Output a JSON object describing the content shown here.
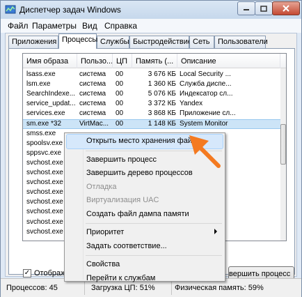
{
  "window": {
    "title": "Диспетчер задач Windows"
  },
  "menu": [
    "Файл",
    "Параметры",
    "Вид",
    "Справка"
  ],
  "tabs": [
    "Приложения",
    "Процессы",
    "Службы",
    "Быстродействие",
    "Сеть",
    "Пользователи"
  ],
  "active_tab": "Процессы",
  "table": {
    "headers": [
      "Имя образа",
      "Пользо...",
      "ЦП",
      "Память (...",
      "Описание"
    ],
    "rows": [
      {
        "name": "lsass.exe",
        "user": "система",
        "cpu": "00",
        "mem": "3 676 КБ",
        "desc": "Local Security ..."
      },
      {
        "name": "lsm.exe",
        "user": "система",
        "cpu": "00",
        "mem": "1 360 КБ",
        "desc": "Служба диспе..."
      },
      {
        "name": "SearchIndexe...",
        "user": "система",
        "cpu": "00",
        "mem": "5 076 КБ",
        "desc": "Индексатор сл..."
      },
      {
        "name": "service_updat...",
        "user": "система",
        "cpu": "00",
        "mem": "3 372 КБ",
        "desc": "Yandex"
      },
      {
        "name": "services.exe",
        "user": "система",
        "cpu": "00",
        "mem": "3 868 КБ",
        "desc": "Приложение сл..."
      },
      {
        "name": "sm.exe *32",
        "user": "VirtMac...",
        "cpu": "00",
        "mem": "1 148 КБ",
        "desc": "System Monitor"
      },
      {
        "name": "smss.exe",
        "user": "",
        "cpu": "",
        "mem": "",
        "desc": ""
      },
      {
        "name": "spoolsv.exe",
        "user": "",
        "cpu": "",
        "mem": "",
        "desc": ""
      },
      {
        "name": "sppsvc.exe",
        "user": "",
        "cpu": "",
        "mem": "",
        "desc": ""
      },
      {
        "name": "svchost.exe",
        "user": "",
        "cpu": "",
        "mem": "",
        "desc": ""
      },
      {
        "name": "svchost.exe",
        "user": "",
        "cpu": "",
        "mem": "",
        "desc": ""
      },
      {
        "name": "svchost.exe",
        "user": "",
        "cpu": "",
        "mem": "",
        "desc": ""
      },
      {
        "name": "svchost.exe",
        "user": "",
        "cpu": "",
        "mem": "",
        "desc": ""
      },
      {
        "name": "svchost.exe",
        "user": "",
        "cpu": "",
        "mem": "",
        "desc": ""
      },
      {
        "name": "svchost.exe",
        "user": "",
        "cpu": "",
        "mem": "",
        "desc": ""
      },
      {
        "name": "svchost.exe",
        "user": "",
        "cpu": "",
        "mem": "",
        "desc": ""
      },
      {
        "name": "svchost.exe",
        "user": "",
        "cpu": "",
        "mem": "",
        "desc": ""
      }
    ],
    "selected_row": 5
  },
  "show_all_checkbox": {
    "label": "Отображат",
    "checked": true
  },
  "end_process_button": "вершить процесс",
  "status": {
    "processes": "Процессов: 45",
    "cpu": "Загрузка ЦП: 51%",
    "memory": "Физическая память: 59%"
  },
  "context_menu": [
    {
      "label": "Открыть место хранения файла",
      "highlight": true
    },
    {
      "sep": true
    },
    {
      "label": "Завершить процесс"
    },
    {
      "label": "Завершить дерево процессов"
    },
    {
      "label": "Отладка",
      "disabled": true
    },
    {
      "label": "Виртуализация UAC",
      "disabled": true
    },
    {
      "label": "Создать файл дампа памяти"
    },
    {
      "sep": true
    },
    {
      "label": "Приоритет",
      "submenu": true
    },
    {
      "label": "Задать соответствие..."
    },
    {
      "sep": true
    },
    {
      "label": "Свойства"
    },
    {
      "label": "Перейти к службам"
    }
  ],
  "colors": {
    "annotation_arrow": "#f47a20",
    "selection": "#cce4f7"
  }
}
